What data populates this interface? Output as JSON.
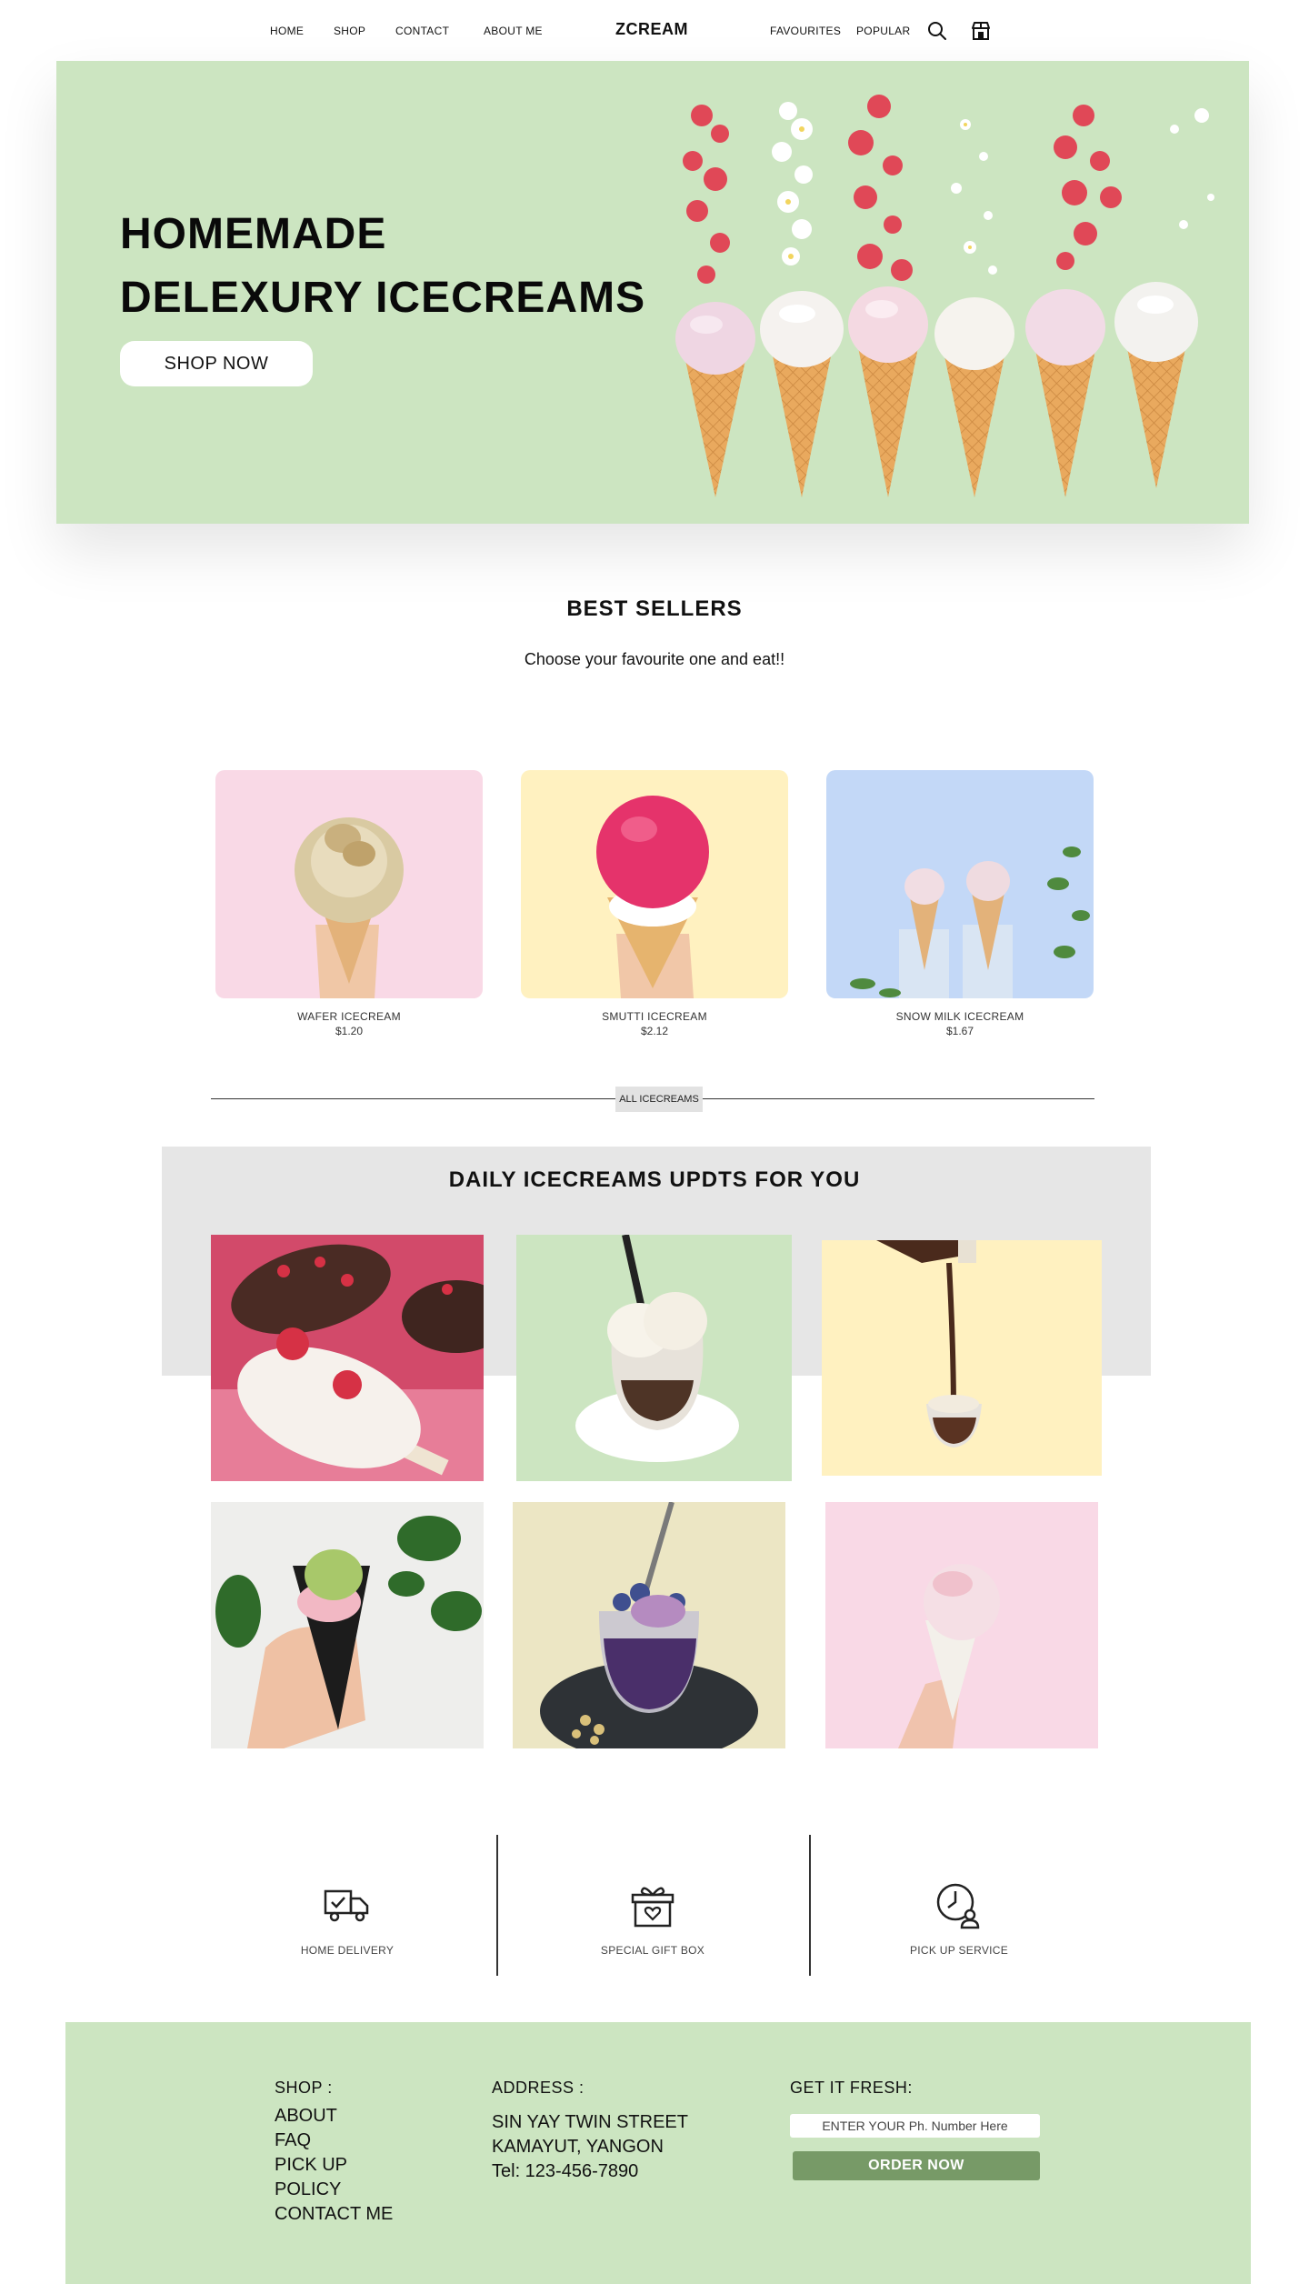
{
  "nav": {
    "left_items": [
      "HOME",
      "SHOP",
      "CONTACT",
      "ABOUT ME"
    ],
    "brand": "ZCREAM",
    "right_items": [
      "FAVOURITES",
      "POPULAR"
    ],
    "icons": [
      "search-icon",
      "shop-icon"
    ]
  },
  "hero": {
    "title_line1": "HOMEMADE",
    "title_line2": "DELEXURY ICECREAMS",
    "cta": "SHOP NOW",
    "bg_color": "#cce5c1"
  },
  "best_sellers": {
    "title": "BEST  SELLERS",
    "subtitle": "Choose your favourite one  and eat!!",
    "products": [
      {
        "name": "WAFER ICECREAM",
        "price": "$1.20",
        "bg": "#f9d9e6"
      },
      {
        "name": "SMUTTI ICECREAM",
        "price": "$2.12",
        "bg": "#fff1c0"
      },
      {
        "name": "SNOW MILK ICECREAM",
        "price": "$1.67",
        "bg": "#c3d8f7"
      }
    ]
  },
  "all_icecreams": {
    "label": "ALL ICECREAMS"
  },
  "daily": {
    "title": "DAILY ICECREAMS UPDTS FOR YOU"
  },
  "services": [
    {
      "label": "HOME DELIVERY",
      "icon": "delivery-truck-icon"
    },
    {
      "label": "SPECIAL GIFT  BOX",
      "icon": "gift-box-icon"
    },
    {
      "label": "PICK UP SERVICE",
      "icon": "clock-person-icon"
    }
  ],
  "footer": {
    "shop_head": "SHOP :",
    "links": [
      "ABOUT",
      "FAQ",
      "PICK UP",
      "POLICY",
      "CONTACT ME"
    ],
    "address_head": "ADDRESS :",
    "address_lines": [
      "SIN YAY TWIN STREET",
      "KAMAYUT, YANGON",
      "Tel: 123-456-7890"
    ],
    "fresh_head": "GET IT FRESH:",
    "phone_placeholder": "ENTER YOUR Ph. Number Here",
    "order_button": "ORDER NOW",
    "button_color": "#779a67"
  }
}
